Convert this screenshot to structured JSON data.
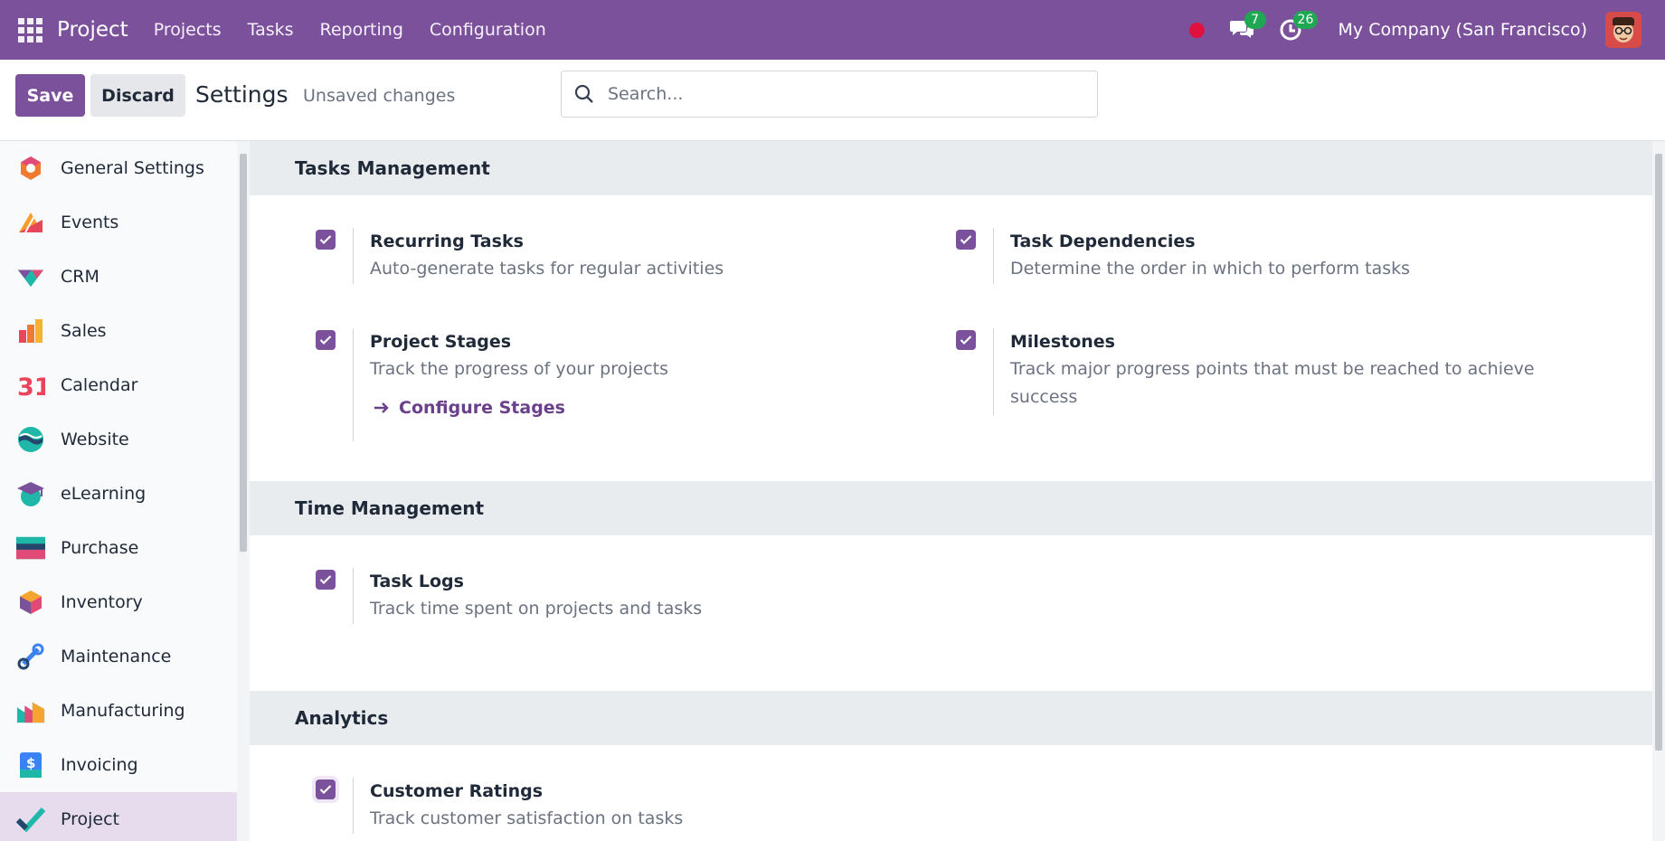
{
  "navbar": {
    "brand": "Project",
    "menu": [
      "Projects",
      "Tasks",
      "Reporting",
      "Configuration"
    ],
    "messages_count": "7",
    "activities_count": "26",
    "company": "My Company (San Francisco)",
    "accent": "#7c519c"
  },
  "control": {
    "save_label": "Save",
    "discard_label": "Discard",
    "title": "Settings",
    "status": "Unsaved changes",
    "search_placeholder": "Search..."
  },
  "sidebar": {
    "items": [
      {
        "label": "General Settings",
        "icon": "general-settings-icon"
      },
      {
        "label": "Events",
        "icon": "events-icon"
      },
      {
        "label": "CRM",
        "icon": "crm-icon"
      },
      {
        "label": "Sales",
        "icon": "sales-icon"
      },
      {
        "label": "Calendar",
        "icon": "calendar-icon",
        "glyph": "31"
      },
      {
        "label": "Website",
        "icon": "website-icon"
      },
      {
        "label": "eLearning",
        "icon": "elearning-icon"
      },
      {
        "label": "Purchase",
        "icon": "purchase-icon"
      },
      {
        "label": "Inventory",
        "icon": "inventory-icon"
      },
      {
        "label": "Maintenance",
        "icon": "maintenance-icon"
      },
      {
        "label": "Manufacturing",
        "icon": "manufacturing-icon"
      },
      {
        "label": "Invoicing",
        "icon": "invoicing-icon",
        "glyph": "$"
      },
      {
        "label": "Project",
        "icon": "project-icon",
        "active": true
      }
    ]
  },
  "sections": {
    "tasks_management": {
      "title": "Tasks Management",
      "recurring": {
        "title": "Recurring Tasks",
        "desc": "Auto-generate tasks for regular activities",
        "checked": true
      },
      "dependencies": {
        "title": "Task Dependencies",
        "desc": "Determine the order in which to perform tasks",
        "checked": true
      },
      "stages": {
        "title": "Project Stages",
        "desc": "Track the progress of your projects",
        "link": "Configure Stages",
        "checked": true
      },
      "milestones": {
        "title": "Milestones",
        "desc_line1": "Track major progress points that must be reached to achieve",
        "desc_line2": "success",
        "checked": true
      }
    },
    "time_management": {
      "title": "Time Management",
      "task_logs": {
        "title": "Task Logs",
        "desc": "Track time spent on projects and tasks",
        "checked": true
      }
    },
    "analytics": {
      "title": "Analytics",
      "ratings": {
        "title": "Customer Ratings",
        "desc": "Track customer satisfaction on tasks",
        "checked": true
      }
    }
  }
}
